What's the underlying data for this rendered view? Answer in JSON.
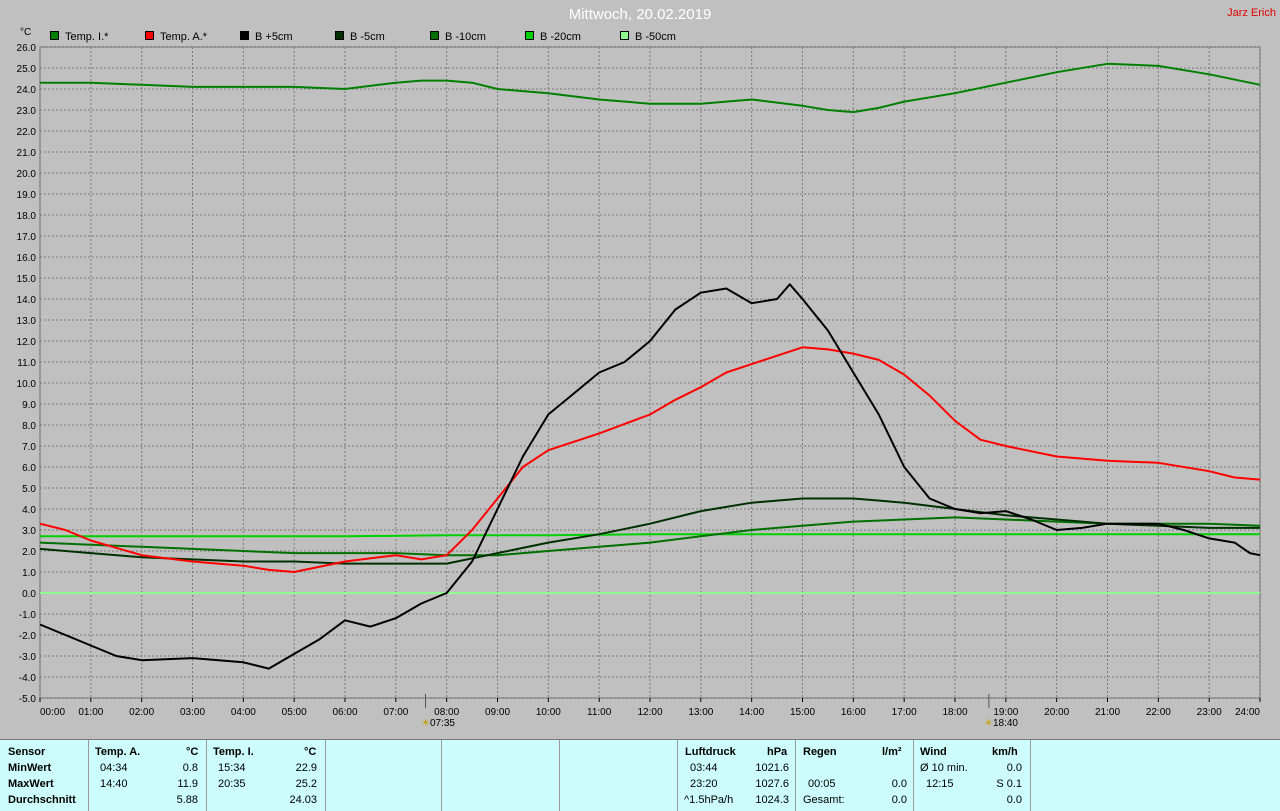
{
  "title": "Mittwoch, 20.02.2019",
  "author": "Jarz Erich",
  "y_unit": "°C",
  "legend": [
    {
      "label": "Temp. I.*",
      "color": "#008000"
    },
    {
      "label": "Temp. A.*",
      "color": "#ff0000"
    },
    {
      "label": "B +5cm",
      "color": "#000000"
    },
    {
      "label": "B -5cm",
      "color": "#003000"
    },
    {
      "label": "B -10cm",
      "color": "#007000"
    },
    {
      "label": "B -20cm",
      "color": "#00d000"
    },
    {
      "label": "B -50cm",
      "color": "#90ff90"
    }
  ],
  "sunrise": "07:35",
  "sunset": "18:40",
  "chart_data": {
    "type": "line",
    "title": "Mittwoch, 20.02.2019",
    "ylabel": "°C",
    "ylim": [
      -5,
      26
    ],
    "xlim": [
      0,
      24
    ],
    "grid": true,
    "legend_position": "top-left",
    "x_tick_labels": [
      "00:00",
      "01:00",
      "02:00",
      "03:00",
      "04:00",
      "05:00",
      "06:00",
      "07:00",
      "08:00",
      "09:00",
      "10:00",
      "11:00",
      "12:00",
      "13:00",
      "14:00",
      "15:00",
      "16:00",
      "17:00",
      "18:00",
      "19:00",
      "20:00",
      "21:00",
      "22:00",
      "23:00",
      "24:00"
    ],
    "y_tick_labels": [
      "26.0",
      "25.0",
      "24.0",
      "23.0",
      "22.0",
      "21.0",
      "20.0",
      "19.0",
      "18.0",
      "17.0",
      "16.0",
      "15.0",
      "14.0",
      "13.0",
      "12.0",
      "11.0",
      "10.0",
      "9.0",
      "8.0",
      "7.0",
      "6.0",
      "5.0",
      "4.0",
      "3.0",
      "2.0",
      "1.0",
      "0.0",
      "-1.0",
      "-2.0",
      "-3.0",
      "-4.0",
      "-5.0"
    ],
    "series": [
      {
        "name": "Temp. I.*",
        "color": "#008000",
        "x": [
          0,
          1,
          2,
          3,
          4,
          5,
          6,
          7,
          7.5,
          8,
          8.5,
          9,
          10,
          11,
          12,
          13,
          13.5,
          14,
          15,
          15.5,
          16,
          16.5,
          17,
          18,
          19,
          20,
          21,
          22,
          23,
          24
        ],
        "y": [
          24.3,
          24.3,
          24.2,
          24.1,
          24.1,
          24.1,
          24.0,
          24.3,
          24.4,
          24.4,
          24.3,
          24.0,
          23.8,
          23.5,
          23.3,
          23.3,
          23.4,
          23.5,
          23.2,
          23.0,
          22.9,
          23.1,
          23.4,
          23.8,
          24.3,
          24.8,
          25.2,
          25.1,
          24.7,
          24.2
        ]
      },
      {
        "name": "Temp. A.*",
        "color": "#ff0000",
        "x": [
          0,
          0.5,
          1,
          2,
          3,
          4,
          4.5,
          5,
          6,
          7,
          7.5,
          8,
          8.5,
          9,
          9.5,
          10,
          10.5,
          11,
          12,
          12.5,
          13,
          13.5,
          14,
          14.5,
          15,
          15.5,
          16,
          16.5,
          17,
          17.5,
          18,
          18.5,
          19,
          20,
          21,
          22,
          23,
          23.5,
          24
        ],
        "y": [
          3.3,
          3.0,
          2.5,
          1.8,
          1.5,
          1.3,
          1.1,
          1.0,
          1.5,
          1.8,
          1.6,
          1.8,
          3.0,
          4.5,
          6.0,
          6.8,
          7.2,
          7.6,
          8.5,
          9.2,
          9.8,
          10.5,
          10.9,
          11.3,
          11.7,
          11.6,
          11.4,
          11.1,
          10.4,
          9.4,
          8.2,
          7.3,
          7.0,
          6.5,
          6.3,
          6.2,
          5.8,
          5.5,
          5.4
        ]
      },
      {
        "name": "B +5cm",
        "color": "#000000",
        "x": [
          0,
          0.5,
          1,
          1.5,
          2,
          3,
          4,
          4.5,
          5,
          5.5,
          6,
          6.5,
          7,
          7.5,
          8,
          8.5,
          9,
          9.5,
          10,
          10.5,
          11,
          11.5,
          12,
          12.5,
          13,
          13.5,
          14,
          14.5,
          14.75,
          15,
          15.5,
          16,
          16.5,
          17,
          17.5,
          18,
          18.5,
          19,
          19.5,
          20,
          20.5,
          21,
          21.5,
          22,
          22.5,
          23,
          23.5,
          23.8,
          24
        ],
        "y": [
          -1.5,
          -2.0,
          -2.5,
          -3.0,
          -3.2,
          -3.1,
          -3.3,
          -3.6,
          -2.9,
          -2.2,
          -1.3,
          -1.6,
          -1.2,
          -0.5,
          0.0,
          1.5,
          4.0,
          6.5,
          8.5,
          9.5,
          10.5,
          11.0,
          12.0,
          13.5,
          14.3,
          14.5,
          13.8,
          14.0,
          14.7,
          14.0,
          12.5,
          10.5,
          8.5,
          6.0,
          4.5,
          4.0,
          3.8,
          3.9,
          3.5,
          3.0,
          3.1,
          3.3,
          3.3,
          3.3,
          3.0,
          2.6,
          2.4,
          1.9,
          1.8
        ]
      },
      {
        "name": "B -5cm",
        "color": "#003000",
        "x": [
          0,
          1,
          2,
          3,
          4,
          5,
          6,
          7,
          8,
          9,
          10,
          11,
          12,
          13,
          14,
          15,
          16,
          17,
          18,
          19,
          20,
          21,
          22,
          23,
          24
        ],
        "y": [
          2.1,
          1.9,
          1.7,
          1.6,
          1.5,
          1.5,
          1.4,
          1.4,
          1.4,
          1.9,
          2.4,
          2.8,
          3.3,
          3.9,
          4.3,
          4.5,
          4.5,
          4.3,
          4.0,
          3.7,
          3.5,
          3.3,
          3.2,
          3.1,
          3.1
        ]
      },
      {
        "name": "B -10cm",
        "color": "#007000",
        "x": [
          0,
          1,
          2,
          3,
          4,
          5,
          6,
          7,
          8,
          9,
          10,
          11,
          12,
          13,
          14,
          15,
          16,
          17,
          18,
          19,
          20,
          21,
          22,
          23,
          24
        ],
        "y": [
          2.4,
          2.3,
          2.2,
          2.1,
          2.0,
          1.9,
          1.9,
          1.9,
          1.8,
          1.8,
          2.0,
          2.2,
          2.4,
          2.7,
          3.0,
          3.2,
          3.4,
          3.5,
          3.6,
          3.5,
          3.4,
          3.3,
          3.3,
          3.3,
          3.2
        ]
      },
      {
        "name": "B -20cm",
        "color": "#00d000",
        "x": [
          0,
          2,
          4,
          6,
          8,
          10,
          12,
          14,
          16,
          18,
          20,
          22,
          24
        ],
        "y": [
          2.7,
          2.7,
          2.7,
          2.7,
          2.75,
          2.75,
          2.8,
          2.8,
          2.8,
          2.8,
          2.8,
          2.8,
          2.8
        ]
      },
      {
        "name": "B -50cm",
        "color": "#90ff90",
        "x": [
          0,
          24
        ],
        "y": [
          0.0,
          0.0
        ]
      }
    ]
  },
  "stats": {
    "sensor_header": "Sensor",
    "row_labels": [
      "MinWert",
      "MaxWert",
      "Durchschnitt"
    ],
    "temp_a": {
      "header": "Temp. A.",
      "unit": "°C",
      "min_time": "04:34",
      "min_val": "0.8",
      "max_time": "14:40",
      "max_val": "11.9",
      "avg_val": "5.88"
    },
    "temp_i": {
      "header": "Temp. I.",
      "unit": "°C",
      "min_time": "15:34",
      "min_val": "22.9",
      "max_time": "20:35",
      "max_val": "25.2",
      "avg_val": "24.03"
    },
    "pressure": {
      "header": "Luftdruck",
      "unit": "hPa",
      "min_time": "03:44",
      "min_val": "1021.6",
      "max_time": "23:20",
      "max_val": "1027.6",
      "trend_label": "^1.5hPa/h",
      "trend_val": "1024.3"
    },
    "rain": {
      "header": "Regen",
      "unit": "l/m²",
      "max_time": "00:05",
      "max_val": "0.0",
      "total_label": "Gesamt:",
      "total_val": "0.0"
    },
    "wind": {
      "header": "Wind",
      "unit": "km/h",
      "avg_label": "Ø 10 min.",
      "avg_val": "0.0",
      "max_time": "12:15",
      "max_val": "S 0.1",
      "last_val": "0.0"
    }
  }
}
